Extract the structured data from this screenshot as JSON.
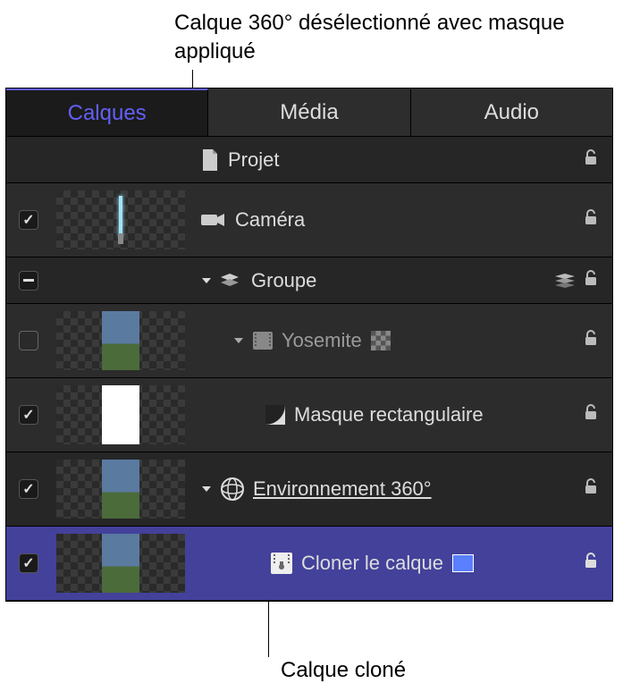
{
  "annotations": {
    "top": "Calque 360° désélectionné avec masque appliqué",
    "bottom": "Calque cloné"
  },
  "tabs": {
    "layers": "Calques",
    "media": "Média",
    "audio": "Audio"
  },
  "rows": {
    "project": "Projet",
    "camera": "Caméra",
    "group": "Groupe",
    "yosemite": "Yosemite",
    "rectmask": "Masque rectangulaire",
    "env360": "Environnement 360°",
    "clone": "Cloner le calque"
  }
}
